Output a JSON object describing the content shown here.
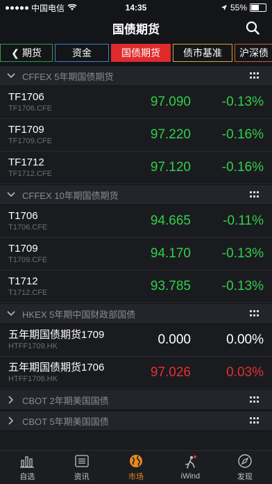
{
  "status": {
    "carrier": "中国电信",
    "time": "14:35",
    "battery": "55%"
  },
  "header": {
    "title": "国债期货"
  },
  "tabs": [
    "期货",
    "资金",
    "国债期货",
    "债市基准",
    "沪深债"
  ],
  "sections": [
    {
      "title": "CFFEX 5年期国债期货",
      "expanded": true,
      "rows": [
        {
          "name": "TF1706",
          "code": "TF1706.CFE",
          "price": "97.090",
          "change": "-0.13%",
          "price_color": "green",
          "change_color": "green"
        },
        {
          "name": "TF1709",
          "code": "TF1709.CFE",
          "price": "97.220",
          "change": "-0.16%",
          "price_color": "green",
          "change_color": "green"
        },
        {
          "name": "TF1712",
          "code": "TF1712.CFE",
          "price": "97.120",
          "change": "-0.16%",
          "price_color": "green",
          "change_color": "green"
        }
      ]
    },
    {
      "title": "CFFEX 10年期国债期货",
      "expanded": true,
      "rows": [
        {
          "name": "T1706",
          "code": "T1706.CFE",
          "price": "94.665",
          "change": "-0.11%",
          "price_color": "green",
          "change_color": "green"
        },
        {
          "name": "T1709",
          "code": "T1709.CFE",
          "price": "94.170",
          "change": "-0.13%",
          "price_color": "green",
          "change_color": "green"
        },
        {
          "name": "T1712",
          "code": "T1712.CFE",
          "price": "93.785",
          "change": "-0.13%",
          "price_color": "green",
          "change_color": "green"
        }
      ]
    },
    {
      "title": "HKEX 5年期中国财政部国债",
      "expanded": true,
      "rows": [
        {
          "name": "五年期国债期货1709",
          "code": "HTFF1709.HK",
          "price": "0.000",
          "change": "0.00%",
          "price_color": "white",
          "change_color": "white"
        },
        {
          "name": "五年期国债期货1706",
          "code": "HTFF1706.HK",
          "price": "97.026",
          "change": "0.03%",
          "price_color": "red",
          "change_color": "red"
        }
      ]
    },
    {
      "title": "CBOT 2年期美国国债",
      "expanded": false,
      "rows": []
    },
    {
      "title": "CBOT 5年期美国国债",
      "expanded": false,
      "rows": []
    }
  ],
  "tabbar": [
    {
      "label": "自选",
      "icon": "chart-bars-icon",
      "active": false
    },
    {
      "label": "资讯",
      "icon": "news-list-icon",
      "active": false
    },
    {
      "label": "市场",
      "icon": "globe-icon",
      "active": true
    },
    {
      "label": "iWind",
      "icon": "wind-person-icon",
      "active": false
    },
    {
      "label": "发现",
      "icon": "compass-icon",
      "active": false
    }
  ],
  "colors": {
    "green": "#2fd04a",
    "red": "#e53030",
    "accent": "#e48a1f",
    "tab_active": "#e02b2b"
  }
}
